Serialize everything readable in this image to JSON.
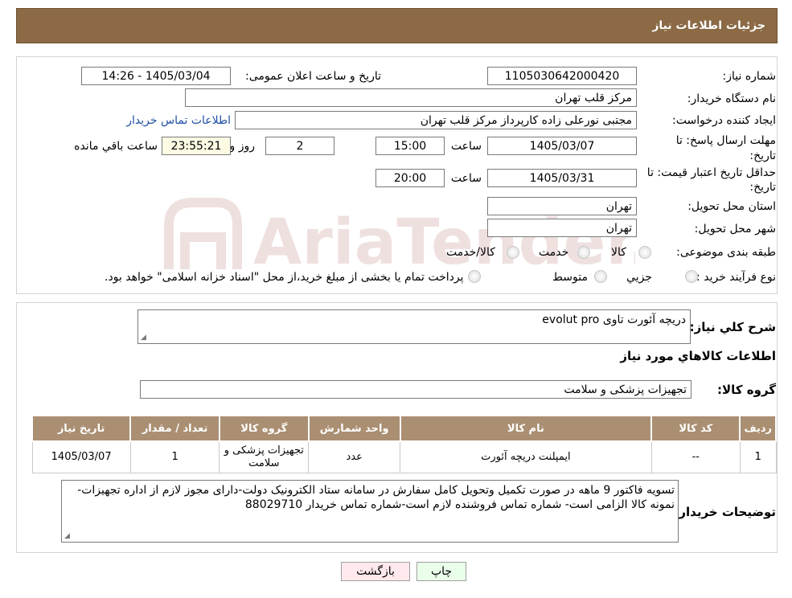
{
  "header": {
    "title": "جزئیات اطلاعات نیاز"
  },
  "fields": {
    "need_number_label": "شماره نیاز:",
    "need_number": "1105030642000420",
    "announce_label": "تاریخ و ساعت اعلان عمومی:",
    "announce_value": "1405/03/04 - 14:26",
    "buyer_org_label": "نام دستگاه خریدار:",
    "buyer_org": "مرکز قلب تهران",
    "requester_label": "ایجاد کننده درخواست:",
    "requester": "مجتبی نورعلی زاده کارپرداز مرکز قلب تهران",
    "contact_link": "اطلاعات تماس خریدار",
    "deadline_label_1": "مهلت ارسال پاسخ: تا",
    "deadline_label_2": "تاریخ:",
    "deadline_date": "1405/03/07",
    "time_label": "ساعت",
    "deadline_time": "15:00",
    "days_value": "2",
    "days_label": "روز و",
    "remaining_time": "23:55:21",
    "remaining_label": "ساعت باقي مانده",
    "validity_label_1": "حداقل تاريخ اعتبار قيمت: تا",
    "validity_label_2": "تاريخ:",
    "validity_date": "1405/03/31",
    "validity_time": "20:00",
    "province_label": "استان محل تحویل:",
    "province": "تهران",
    "city_label": "شهر محل تحویل:",
    "city": "تهران",
    "category_label": "طبقه بندی موضوعی:",
    "category_options": [
      "کالا",
      "خدمت",
      "کالا/خدمت"
    ],
    "process_label": "نوع فرآیند خرید :",
    "process_options": [
      "جزیي",
      "متوسط"
    ],
    "process_note": "پرداخت تمام یا بخشی از مبلغ خرید،از محل \"اسناد خزانه اسلامی\" خواهد بود."
  },
  "watermark": {
    "text": "AriaTender.neT"
  },
  "general": {
    "description_label": "شرح کلي نياز:",
    "description": "دریچه آئورت تاوی evolut pro",
    "goods_info_title": "اطلاعات کالاهاي مورد نياز",
    "goods_group_label": "گروه کالا:",
    "goods_group": "تجهیزات پزشکی و سلامت"
  },
  "table": {
    "headers": [
      "رديف",
      "کد کالا",
      "نام کالا",
      "واحد شمارش",
      "گروه کالا",
      "تعداد / مقدار",
      "تاریخ نیاز"
    ],
    "rows": [
      [
        "1",
        "--",
        "ایمپلنت دریچه آئورت",
        "عدد",
        "تجهیزات پزشکی و سلامت",
        "1",
        "1405/03/07"
      ]
    ]
  },
  "buyer_notes": {
    "label": "توضيحات خريدار:",
    "text": "تسویه فاکتور 9 ماهه در صورت تکمیل وتحویل کامل سفارش در سامانه  ستاد الکترونیک دولت-دارای مجوز لازم از اداره تجهیزات-نمونه کالا الزامی است- شماره تماس فروشنده لازم است-شماره تماس خریدار 88029710"
  },
  "buttons": {
    "print": "چاپ",
    "back": "بازگشت"
  },
  "colors": {
    "header_bg": "#8b6a45",
    "table_header_bg": "#ab8f72",
    "link": "#1f4fa5",
    "print_bg": "#eaffea",
    "back_bg": "#ffe9ec"
  }
}
